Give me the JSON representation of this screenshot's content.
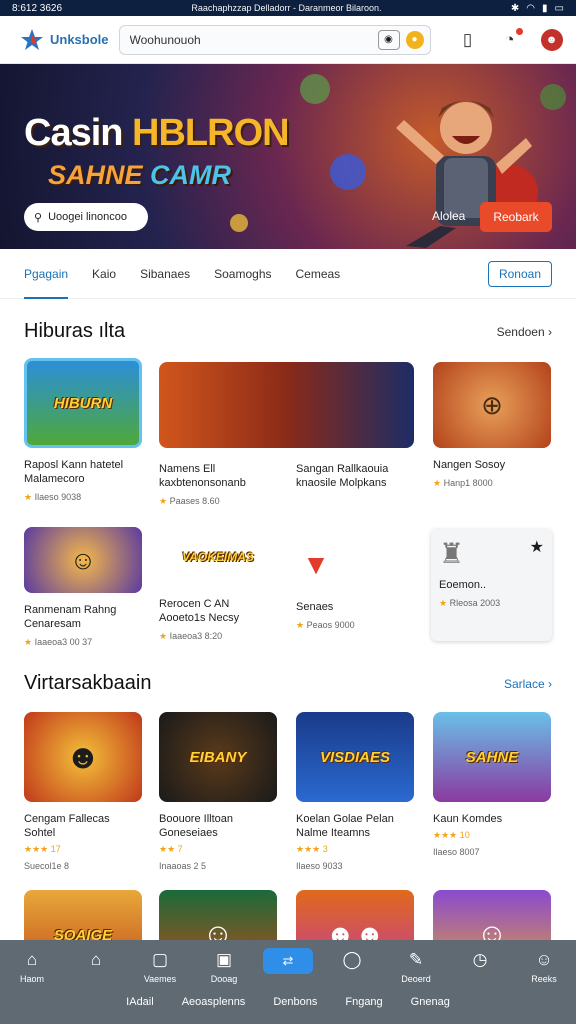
{
  "status": {
    "time": "8:612 3626",
    "title": "Raachaphzzap Delladorr - Daranmeor Bilaroon.",
    "icons": [
      "bluetooth-icon",
      "wifi-icon",
      "signal-icon",
      "battery-icon"
    ]
  },
  "topbar": {
    "brand": "Unksbole",
    "search_value": "Woohunouoh"
  },
  "hero": {
    "title_a": "Casin ",
    "title_b": "HBLRON",
    "subtitle_a": "SAHNE ",
    "subtitle_b": "CAMR",
    "search_text": "Uoogei linoncoo",
    "link": "Alolea",
    "button": "Reobark"
  },
  "tabs": {
    "items": [
      "Pgagain",
      "Kaio",
      "Sibanaes",
      "Soamoghs",
      "Cemeas"
    ],
    "button": "Ronoan"
  },
  "section1": {
    "title": "Hiburas ılta",
    "link": "Sendoen",
    "cards": [
      {
        "thumb": "HIBURN",
        "title": "Raposl Kann hatetel Malamecoro",
        "meta": "Ilaeso 9038"
      },
      {
        "thumb": "",
        "title": "Namens Ell kaxbtenonsonanb",
        "meta": "Paases 8.60"
      },
      {
        "thumb": "",
        "title": "Sangan Rallkaouia knaosile Molpkans",
        "meta": ""
      },
      {
        "thumb": "",
        "title": "Nangen Sosoy",
        "meta": "Hanp1 8000"
      },
      {
        "thumb": "",
        "title": "Ranmenam Rahng Cenaresam",
        "meta": "Iaaeoa3 00 37"
      },
      {
        "thumb": "VAOKEIMAS",
        "title": "Rerocen C AN Aooeto1s Necsy",
        "meta": "Iaaeoa3 8:20"
      },
      {
        "thumb": "",
        "title": "Senaes",
        "meta": "Peaos 9000"
      },
      {
        "thumb": "",
        "title": "Eoemon..",
        "meta": "Rleosa 2003"
      }
    ]
  },
  "section2": {
    "title": "Virtarsakbaain",
    "link": "Sarlace",
    "cards": [
      {
        "thumb": "",
        "title": "Cengam Fallecas Sohtel",
        "stars": "★★★ 17",
        "meta": "Suecol1e 8"
      },
      {
        "thumb": "EIBANY",
        "title": "Boouore Illtoan Goneseiaes",
        "stars": "★★ 7",
        "meta": "Inaaoas 2 5"
      },
      {
        "thumb": "VISDIAES",
        "title": "Koelan Golae Pelan Nalme Iteamns",
        "stars": "★★★ 3",
        "meta": "Ilaeso 9033"
      },
      {
        "thumb": "SAHNE",
        "title": "Kaun Komdes",
        "stars": "★★★ 10",
        "meta": "Ilaeso 8007"
      },
      {
        "thumb": "SOAIGE",
        "title": "",
        "stars": "",
        "meta": ""
      },
      {
        "thumb": "",
        "title": "",
        "stars": "",
        "meta": ""
      },
      {
        "thumb": "",
        "title": "",
        "stars": "",
        "meta": ""
      },
      {
        "thumb": "",
        "title": "",
        "stars": "",
        "meta": ""
      }
    ]
  },
  "bottom_nav": {
    "items": [
      {
        "label": "Haom",
        "icon": "home-icon"
      },
      {
        "label": "",
        "icon": "house-outline-icon"
      },
      {
        "label": "Vaemes",
        "icon": "chat-icon"
      },
      {
        "label": "Dooag",
        "icon": "image-icon"
      },
      {
        "label": "",
        "icon": "switch-icon"
      },
      {
        "label": "",
        "icon": "message-icon"
      },
      {
        "label": "Deoerd",
        "icon": "edit-icon"
      },
      {
        "label": "",
        "icon": "clock-icon"
      },
      {
        "label": "Reeks",
        "icon": "user-icon"
      }
    ],
    "labels": [
      "IAdail",
      "Aeoasplenns",
      "Denbons",
      "Fngang",
      "Gnenag"
    ]
  }
}
